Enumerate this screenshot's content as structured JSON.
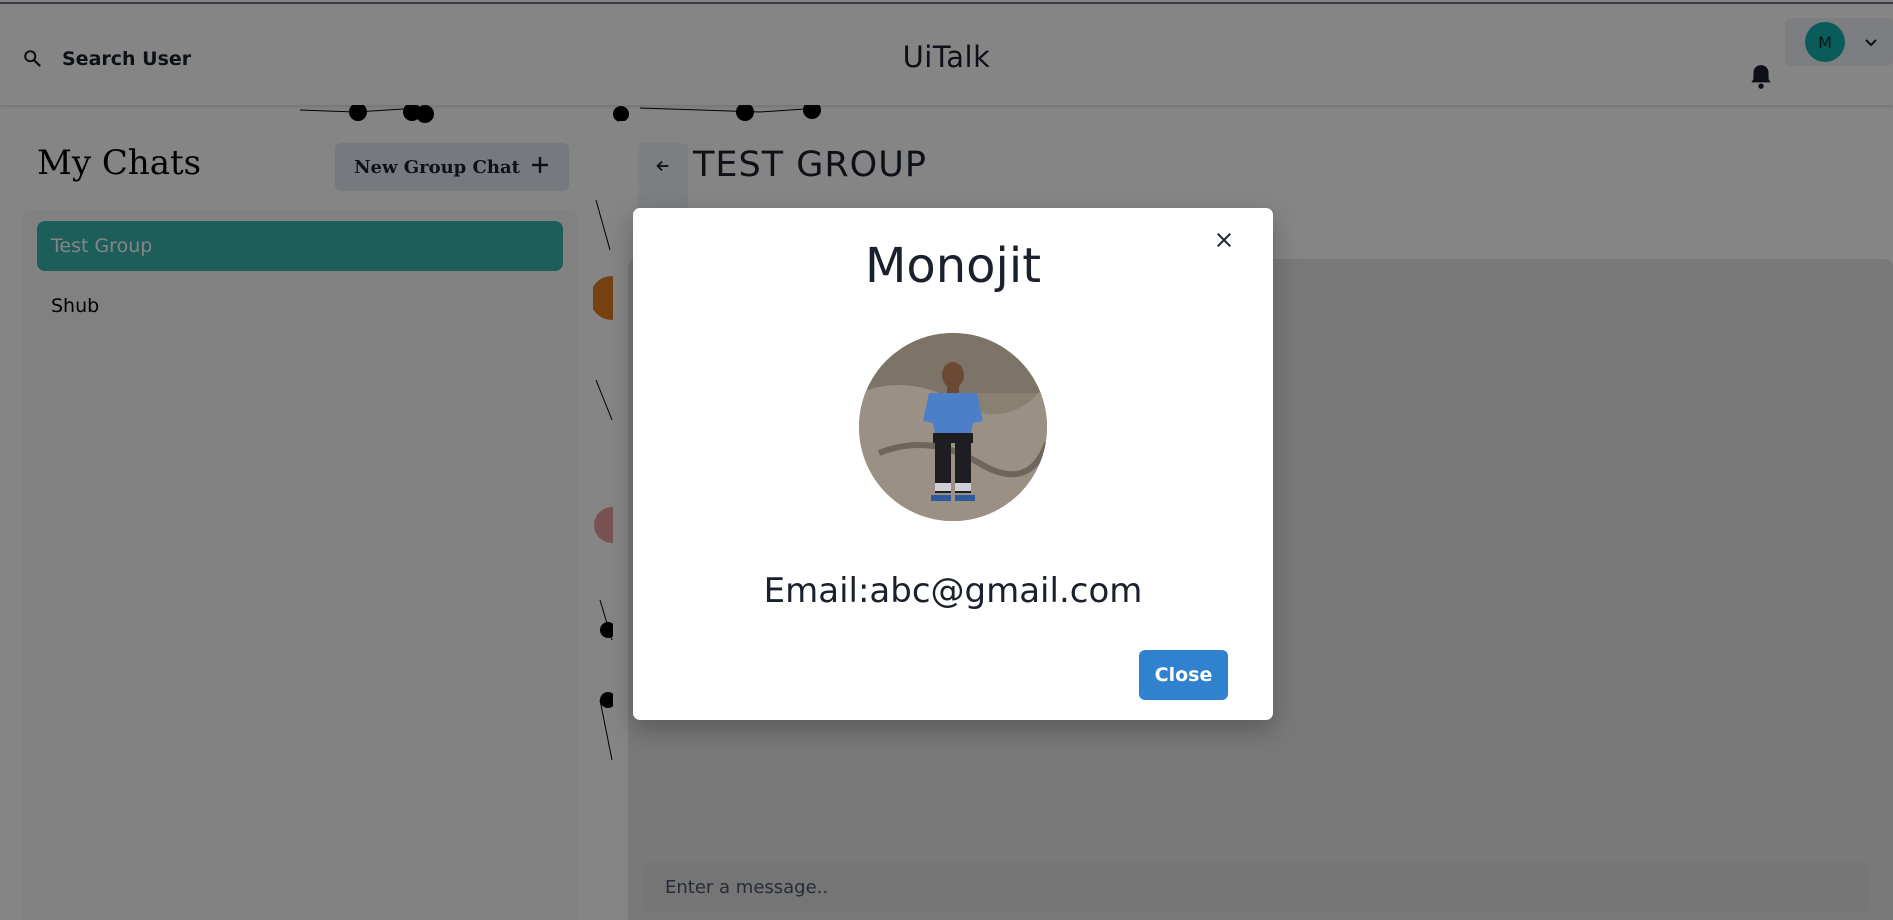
{
  "header": {
    "search_label": "Search User",
    "app_title": "UiTalk",
    "profile_initial": "M"
  },
  "sidebar": {
    "title": "My Chats",
    "new_group_label": "New Group Chat",
    "chats": [
      {
        "name": "Test Group",
        "active": true
      },
      {
        "name": "Shub",
        "active": false
      }
    ]
  },
  "chat": {
    "title": "TEST GROUP",
    "input_placeholder": "Enter a message.."
  },
  "modal": {
    "name": "Monojit",
    "email": "Email:abc@gmail.com",
    "close_label": "Close"
  },
  "colors": {
    "accent_teal": "#38b2ac",
    "avatar_teal": "#14b0ad",
    "primary_blue": "#3182ce",
    "overlay": "rgba(0,0,0,0.48)"
  },
  "icons": {
    "search": "search-icon",
    "bell": "bell-icon",
    "chevron": "chevron-down-icon",
    "plus": "plus-icon",
    "back": "arrow-left-icon",
    "close": "close-icon"
  }
}
